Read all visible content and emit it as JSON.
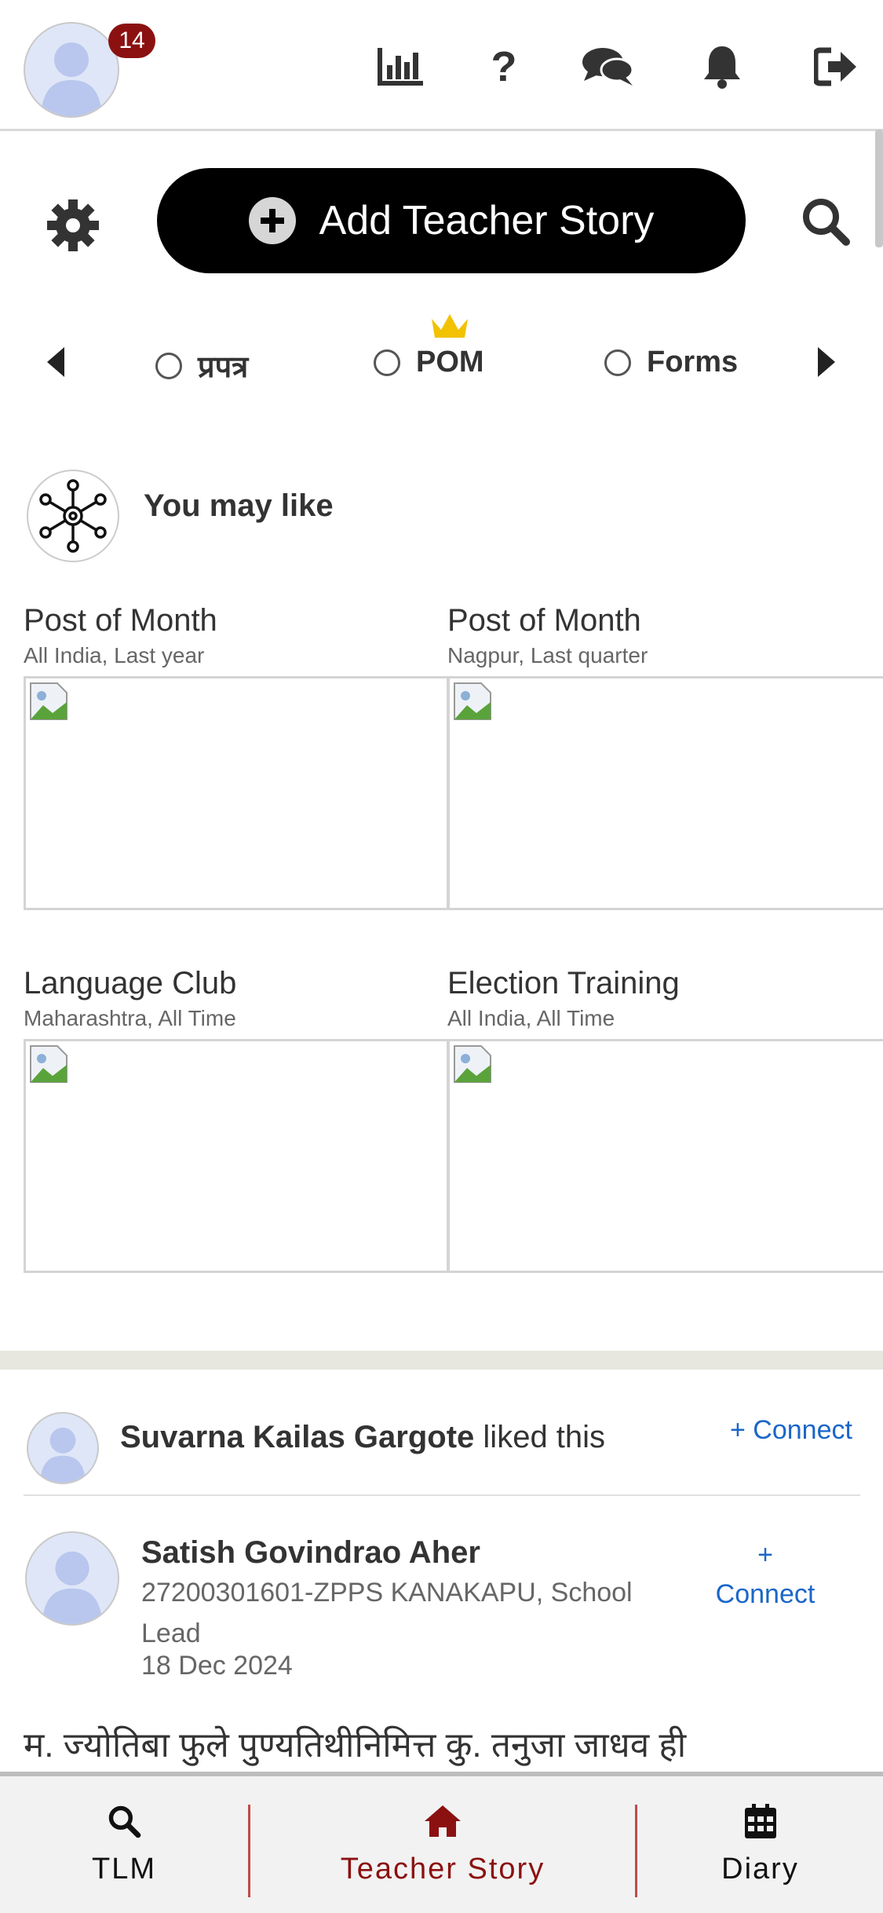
{
  "header": {
    "notification_count": "14",
    "icons": [
      "stats-chart-icon",
      "help-question-icon",
      "chat-icon",
      "bell-icon",
      "logout-icon"
    ]
  },
  "add_story": {
    "label": "Add Teacher Story"
  },
  "tabs": [
    {
      "label": "प्रपत्र"
    },
    {
      "label": "POM",
      "crown": true
    },
    {
      "label": "Forms"
    }
  ],
  "you_may_like": {
    "title": "You may like",
    "cards": [
      {
        "title": "Post of Month",
        "subtitle": "All India, Last year"
      },
      {
        "title": "Post of Month",
        "subtitle": "Nagpur, Last quarter"
      },
      {
        "title": "Language Club",
        "subtitle": "Maharashtra, All Time"
      },
      {
        "title": "Election Training",
        "subtitle": "All India, All Time"
      }
    ]
  },
  "feed": {
    "liker": {
      "name": "Suvarna Kailas Gargote",
      "action": "liked this",
      "connect": "+ Connect"
    },
    "post": {
      "author": "Satish Govindrao Aher",
      "school_line1": "27200301601-ZPPS KANAKAPU, School",
      "school_line2": "Lead",
      "date": "18 Dec 2024",
      "connect_plus": "+",
      "connect_label": "Connect",
      "text": "म. ज्योतिबा फुले पुण्यतिथीनिमित्त कु. तनुजा जाधव ही"
    }
  },
  "bottom_nav": [
    {
      "label": "TLM",
      "icon": "search-icon",
      "active": false
    },
    {
      "label": "Teacher Story",
      "icon": "home-icon",
      "active": true
    },
    {
      "label": "Diary",
      "icon": "calendar-icon",
      "active": false
    }
  ],
  "colors": {
    "accent": "#8b1111",
    "link": "#1a66c9",
    "crown": "#f2c200"
  }
}
